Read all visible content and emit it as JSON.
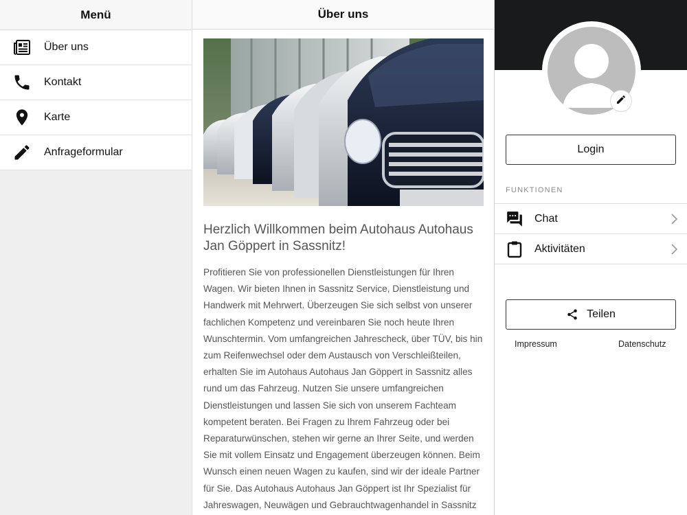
{
  "left_menu": {
    "title": "Menü",
    "items": [
      {
        "label": "Über uns",
        "icon": "newspaper-icon"
      },
      {
        "label": "Kontakt",
        "icon": "phone-icon"
      },
      {
        "label": "Karte",
        "icon": "map-pin-icon"
      },
      {
        "label": "Anfrageformular",
        "icon": "pencil-icon"
      }
    ]
  },
  "main": {
    "title": "Über uns",
    "hero_image": "row of parked cars photo",
    "heading": "Herzlich Willkommen beim Autohaus Autohaus Jan Göppert in Sassnitz!",
    "body": "Profitieren Sie von professionellen Dienstleistungen für Ihren Wagen. Wir bieten Ihnen in Sassnitz Service, Dienstleistung und Handwerk mit Mehrwert. Überzeugen Sie sich selbst von unserer fachlichen Kompetenz und vereinbaren Sie noch heute Ihren Wunschtermin. Vom umfangreichen Jahrescheck, über TÜV, bis hin zum Reifenwechsel oder dem Austausch von Verschleißteilen, erhalten Sie im Autohaus Autohaus Jan Göppert in Sassnitz alles rund um das Fahrzeug. Nutzen Sie unsere umfangreichen Dienstleistungen und lassen Sie sich von unserem Fachteam kompetent beraten. Bei Fragen zu Ihrem Fahrzeug oder bei Reparaturwünschen, stehen wir gerne an Ihrer Seite, und werden Sie mit vollem Einsatz und Engagement überzeugen können. Beim Wunsch einen neuen Wagen zu kaufen, sind wir der ideale Partner für Sie. Das Autohaus Autohaus Jan Göppert ist Ihr Spezialist für Jahreswagen, Neuwägen und Gebrauchtwagenhandel in Sassnitz"
  },
  "profile": {
    "login_label": "Login",
    "section_label": "FUNKTIONEN",
    "functions": [
      {
        "label": "Chat",
        "icon": "chat-icon"
      },
      {
        "label": "Aktivitäten",
        "icon": "clipboard-icon"
      }
    ],
    "share_label": "Teilen",
    "footer": {
      "impressum": "Impressum",
      "datenschutz": "Datenschutz"
    }
  },
  "colors": {
    "header_dark": "#181a1c",
    "avatar_gray": "#bdbdbd",
    "body_text": "#555555"
  }
}
